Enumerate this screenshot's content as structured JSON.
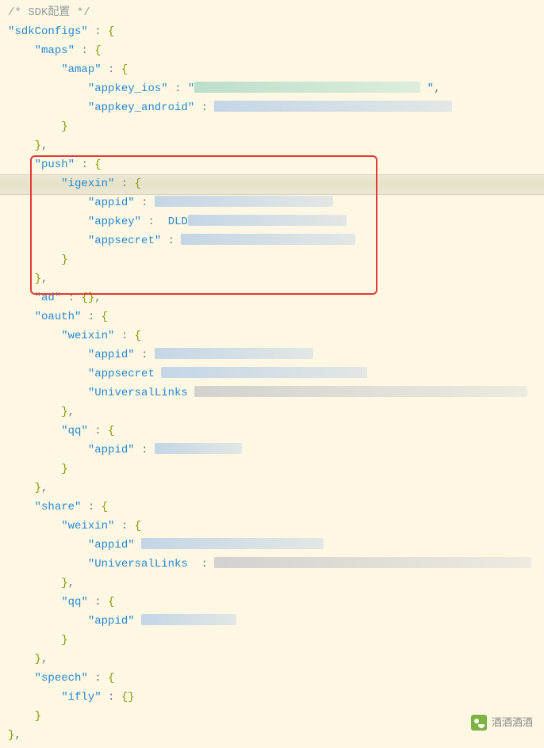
{
  "comment": "/* SDK配置 */",
  "sdk": {
    "root_key": "sdkConfigs",
    "maps": {
      "key": "maps",
      "amap": {
        "key": "amap",
        "appkey_ios": "appkey_ios",
        "appkey_android": "appkey_android"
      }
    },
    "push": {
      "key": "push",
      "igexin": {
        "key": "igexin",
        "appid": "appid",
        "appkey": "appkey",
        "appsecret": "appsecret"
      }
    },
    "ad": {
      "key": "ad"
    },
    "oauth": {
      "key": "oauth",
      "weixin": {
        "key": "weixin",
        "appid": "appid",
        "appsecret": "appsecret",
        "UniversalLinks": "UniversalLinks"
      },
      "qq": {
        "key": "qq",
        "appid": "appid"
      }
    },
    "share": {
      "key": "share",
      "weixin": {
        "key": "weixin",
        "appid": "appid",
        "UniversalLinks": "UniversalLinks"
      },
      "qq": {
        "key": "qq",
        "appid": "appid"
      }
    },
    "speech": {
      "key": "speech",
      "ifly": "ifly"
    }
  },
  "watermark": "酒酒酒酒",
  "redacted_hint": "DLD"
}
